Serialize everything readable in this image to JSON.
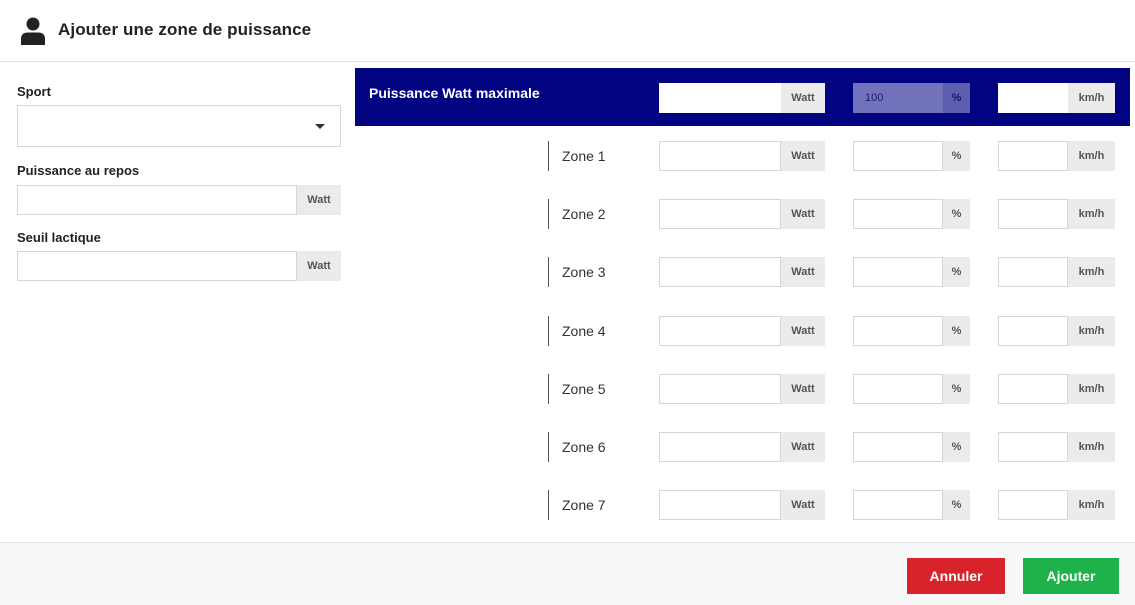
{
  "header": {
    "title": "Ajouter une zone de puissance",
    "icon": "user-icon"
  },
  "left": {
    "sport_label": "Sport",
    "sport_value": "",
    "rest_label": "Puissance au repos",
    "rest_value": "",
    "rest_unit": "Watt",
    "lactate_label": "Seuil lactique",
    "lactate_value": "",
    "lactate_unit": "Watt"
  },
  "max": {
    "label": "Puissance Watt maximale",
    "watt_value": "",
    "watt_unit": "Watt",
    "pct_value": "100",
    "pct_unit": "%",
    "speed_value": "",
    "speed_unit": "km/h"
  },
  "zones": [
    {
      "label": "Zone 1",
      "watt_unit": "Watt",
      "pct_unit": "%",
      "speed_unit": "km/h"
    },
    {
      "label": "Zone 2",
      "watt_unit": "Watt",
      "pct_unit": "%",
      "speed_unit": "km/h"
    },
    {
      "label": "Zone 3",
      "watt_unit": "Watt",
      "pct_unit": "%",
      "speed_unit": "km/h"
    },
    {
      "label": "Zone 4",
      "watt_unit": "Watt",
      "pct_unit": "%",
      "speed_unit": "km/h"
    },
    {
      "label": "Zone 5",
      "watt_unit": "Watt",
      "pct_unit": "%",
      "speed_unit": "km/h"
    },
    {
      "label": "Zone 6",
      "watt_unit": "Watt",
      "pct_unit": "%",
      "speed_unit": "km/h"
    },
    {
      "label": "Zone 7",
      "watt_unit": "Watt",
      "pct_unit": "%",
      "speed_unit": "km/h"
    }
  ],
  "footer": {
    "cancel_label": "Annuler",
    "add_label": "Ajouter"
  },
  "colors": {
    "band": "#020381",
    "cancel": "#d9232a",
    "add": "#20b24a"
  }
}
